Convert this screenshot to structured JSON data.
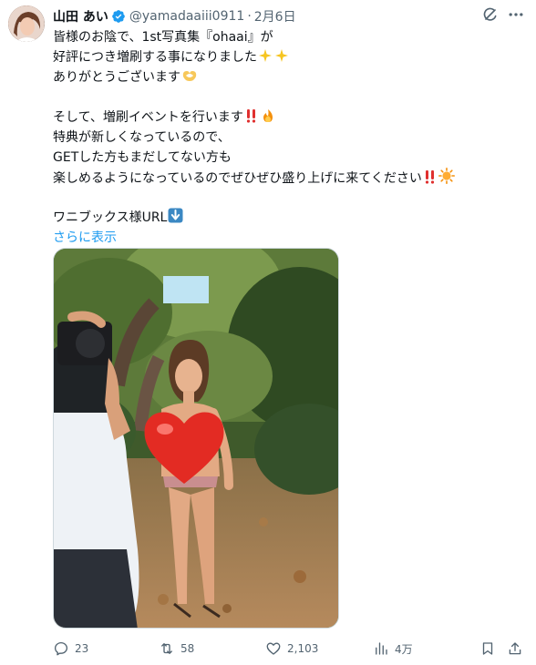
{
  "author": {
    "name": "山田 あい",
    "handle": "@yamadaaiii0911",
    "separator": "·",
    "date": "2月6日"
  },
  "tweet": {
    "lines": [
      "皆様のお陰で、1st写真集『ohaai』が",
      "好評につき増刷する事になりました",
      "ありがとうございます",
      "そして、増刷イベントを行います",
      "特典が新しくなっているので、",
      "GETした方もまだしてない方も",
      "楽しめるようになっているのでぜひぜひ盛り上げに来てください",
      "ワニブックス様URL"
    ],
    "show_more": "さらに表示"
  },
  "icons": {
    "verified": "verified-badge-icon",
    "grok": "grok-icon",
    "more": "more-icon",
    "reply": "reply-icon",
    "retweet": "retweet-icon",
    "like": "heart-icon",
    "views": "views-icon",
    "bookmark": "bookmark-icon",
    "share": "share-icon"
  },
  "stats": {
    "replies": "23",
    "retweets": "58",
    "likes": "2,103",
    "views": "4万"
  },
  "colors": {
    "link": "#1d9bf0",
    "verified": "#1d9bf0",
    "secondary_text": "#536471"
  }
}
